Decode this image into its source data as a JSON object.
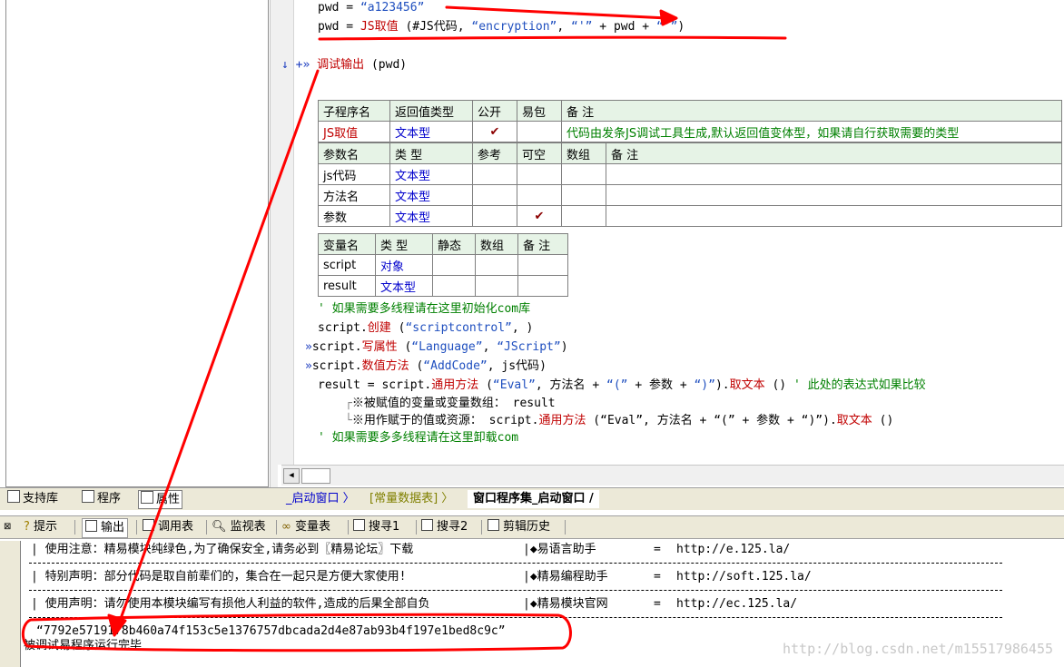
{
  "code": {
    "line1": {
      "lhs": "pwd",
      "op": " = ",
      "val": "“a123456”"
    },
    "line2": {
      "lhs": "pwd",
      "op": " = ",
      "fn": "JS取值",
      "open": " (",
      "arg1": "#JS代码",
      "comma1": ", ",
      "arg2": "“encryption”",
      "comma2": ", ",
      "arg3": "“'”",
      "plus1": " + ",
      "arg4": "pwd",
      "plus2": " + ",
      "arg5": "“'”",
      "close": ")"
    },
    "line3": {
      "marker": "↓ +»",
      "fn": "调试输出",
      "args": " (pwd)"
    },
    "sub_table": {
      "headers": [
        "子程序名",
        "返回值类型",
        "公开",
        "易包",
        "备 注"
      ],
      "row": {
        "name": "JS取值",
        "type": "文本型",
        "public": "✔",
        "note": "代码由发条JS调试工具生成,默认返回值变体型，如果请自行获取需要的类型"
      },
      "param_headers": [
        "参数名",
        "类 型",
        "参考",
        "可空",
        "数组",
        "备 注"
      ],
      "params": [
        {
          "name": "js代码",
          "type": "文本型",
          "nullable": ""
        },
        {
          "name": "方法名",
          "type": "文本型",
          "nullable": ""
        },
        {
          "name": "参数",
          "type": "文本型",
          "nullable": "✔"
        }
      ]
    },
    "var_table": {
      "headers": [
        "变量名",
        "类 型",
        "静态",
        "数组",
        "备 注"
      ],
      "vars": [
        {
          "name": "script",
          "type": "对象"
        },
        {
          "name": "result",
          "type": "文本型"
        }
      ]
    },
    "comment1": "' 如果需要多线程请在这里初始化com库",
    "create": {
      "obj": "script.",
      "fn": "创建",
      "args_open": " (",
      "arg": "“scriptcontrol”",
      "args_close": ", )"
    },
    "write_prop": {
      "marker": "»",
      "obj": "script.",
      "fn": "写属性",
      "open": " (",
      "arg1": "“Language”",
      "sep": ", ",
      "arg2": "“JScript”",
      "close": ")"
    },
    "num_method": {
      "marker": "»",
      "obj": "script.",
      "fn": "数值方法",
      "open": " (",
      "arg1": "“AddCode”",
      "sep": ", ",
      "arg2": "js代码",
      "close": ")"
    },
    "result_line": {
      "lhs": "result",
      "op": " = ",
      "obj": "script.",
      "fn": "通用方法",
      "open": " (",
      "arg1": "“Eval”",
      "sep": ", 方法名 + ",
      "arg2": "“(”",
      "plus": " + 参数 + ",
      "arg3": "“)”",
      "close": ").",
      "fn2": "取文本",
      "tail": " () ",
      "comment": "' 此处的表达式如果比较"
    },
    "hint1": "※被赋值的变量或变量数组： result",
    "hint2_pre": "※用作赋于的值或资源： script.",
    "hint2_fn": "通用方法",
    "hint2_mid": " (“Eval”, 方法名 + “(” + 参数 + “)”).",
    "hint2_fn2": "取文本",
    "hint2_tail": " ()",
    "comment2": "' 如果需要多多线程请在这里卸载com"
  },
  "left_tabs": {
    "lib": "支持库",
    "program": "程序",
    "props": "属性"
  },
  "code_tabs": {
    "tab1": "_启动窗口",
    "tab2": "[常量数据表]",
    "tab3": "窗口程序集_启动窗口"
  },
  "output_tabs": {
    "hint": "提示",
    "output": "输出",
    "calls": "调用表",
    "watch": "监视表",
    "vars": "变量表",
    "search1": "搜寻1",
    "search2": "搜寻2",
    "clip": "剪辑历史"
  },
  "output": {
    "row1_left": "使用注意：精易模块纯绿色,为了确保安全,请务必到〖精易论坛〗下载",
    "row1_right": "◆易语言助手",
    "row1_eq": "=",
    "row1_url": "http://e.125.la/",
    "row2_left": "特别声明：部分代码是取自前辈们的，集合在一起只是方便大家使用!",
    "row2_right": "◆精易编程助手",
    "row2_eq": "=",
    "row2_url": "http://soft.125.la/",
    "row3_left": "使用声明：请勿使用本模块编写有损他人利益的软件,造成的后果全部自负",
    "row3_right": "◆精易模块官网",
    "row3_eq": "=",
    "row3_url": "http://ec.125.la/",
    "result_value": "“7792e5719178b460a74f153c5e1376757dbcada2d4e87ab93b4f197e1bed8c9c”",
    "status": "被调试易程序运行完毕"
  },
  "watermark": "http://blog.csdn.net/m15517986455",
  "colors": {
    "annotation": "#ff0000",
    "keyword": "#c00000",
    "string": "#1f4fbf",
    "comment": "#008000",
    "type": "#0000cc"
  }
}
